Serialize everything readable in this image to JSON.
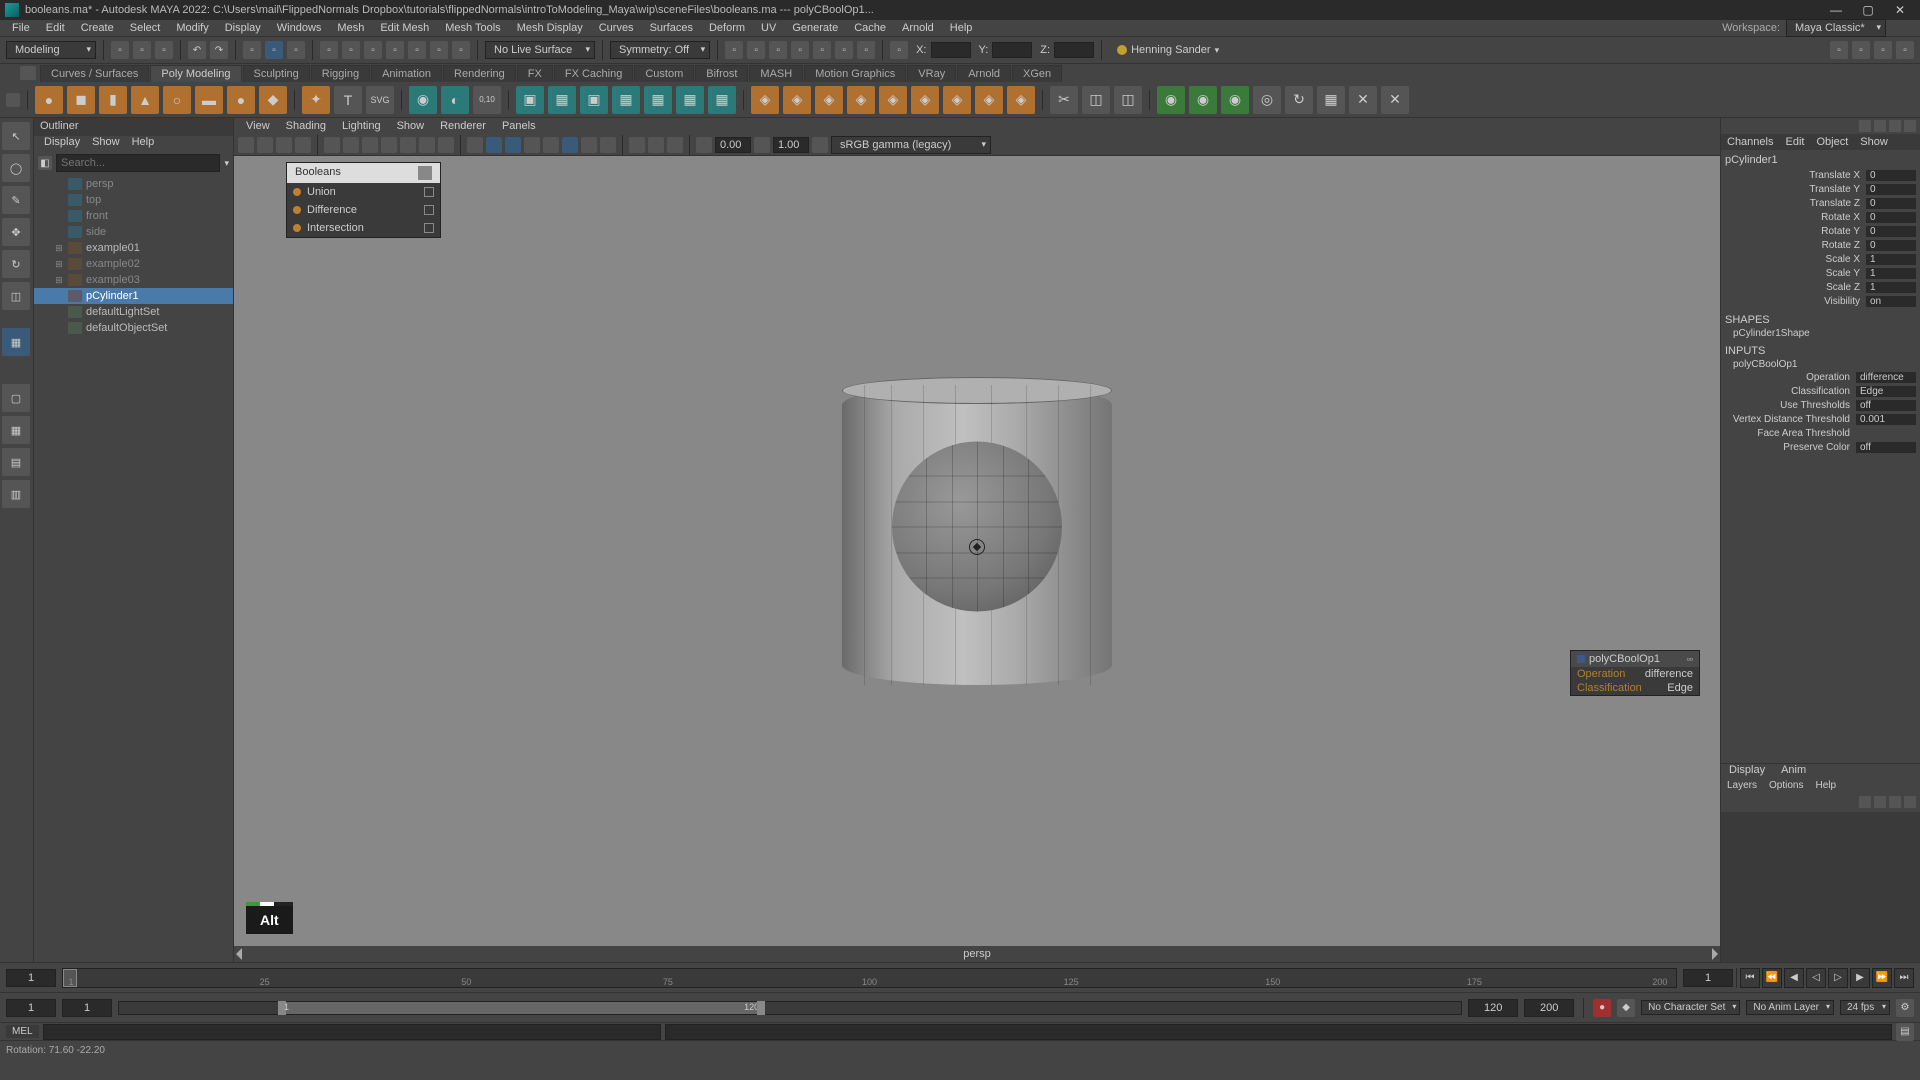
{
  "title": "booleans.ma* - Autodesk MAYA 2022: C:\\Users\\mail\\FlippedNormals Dropbox\\tutorials\\flippedNormals\\introToModeling_Maya\\wip\\sceneFiles\\booleans.ma  ---  polyCBoolOp1...",
  "workspace": {
    "label": "Workspace:",
    "value": "Maya Classic*"
  },
  "modeDropdown": "Modeling",
  "menubar": [
    "File",
    "Edit",
    "Create",
    "Select",
    "Modify",
    "Display",
    "Windows",
    "Mesh",
    "Edit Mesh",
    "Mesh Tools",
    "Mesh Display",
    "Curves",
    "Surfaces",
    "Deform",
    "UV",
    "Generate",
    "Cache",
    "Arnold",
    "Help"
  ],
  "noLiveSurface": "No Live Surface",
  "symmetry": "Symmetry: Off",
  "axes": {
    "x": "X:",
    "y": "Y:",
    "z": "Z:"
  },
  "user": "Henning Sander",
  "shelftabs": [
    "Curves / Surfaces",
    "Poly Modeling",
    "Sculpting",
    "Rigging",
    "Animation",
    "Rendering",
    "FX",
    "FX Caching",
    "Custom",
    "Bifrost",
    "MASH",
    "Motion Graphics",
    "VRay",
    "Arnold",
    "XGen"
  ],
  "shelftab_active": 1,
  "outliner": {
    "title": "Outliner",
    "menu": [
      "Display",
      "Show",
      "Help"
    ],
    "search_placeholder": "Search...",
    "items": [
      {
        "label": "persp",
        "type": "camera"
      },
      {
        "label": "top",
        "type": "camera"
      },
      {
        "label": "front",
        "type": "camera"
      },
      {
        "label": "side",
        "type": "camera"
      },
      {
        "label": "example01",
        "type": "mesh",
        "twisty": "+"
      },
      {
        "label": "example02",
        "type": "mesh",
        "twisty": "+",
        "dim": true
      },
      {
        "label": "example03",
        "type": "mesh",
        "twisty": "+",
        "dim": true
      },
      {
        "label": "pCylinder1",
        "type": "cyl",
        "selected": true
      },
      {
        "label": "defaultLightSet",
        "type": "set"
      },
      {
        "label": "defaultObjectSet",
        "type": "set"
      }
    ]
  },
  "viewport": {
    "menu": [
      "View",
      "Shading",
      "Lighting",
      "Show",
      "Renderer",
      "Panels"
    ],
    "gamma": "sRGB gamma (legacy)",
    "exposure": "0.00",
    "gammaVal": "1.00",
    "camera": "persp"
  },
  "booleans": {
    "title": "Booleans",
    "items": [
      "Union",
      "Difference",
      "Intersection"
    ]
  },
  "key_indicator": "Alt",
  "float_tooltip": {
    "header": "polyCBoolOp1",
    "rows": [
      {
        "k": "Operation",
        "v": "difference"
      },
      {
        "k": "Classification",
        "v": "Edge"
      }
    ]
  },
  "channelbox": {
    "tabs": [
      "Channels",
      "Edit",
      "Object",
      "Show"
    ],
    "obj": "pCylinder1",
    "attrs": [
      {
        "name": "Translate X",
        "val": "0"
      },
      {
        "name": "Translate Y",
        "val": "0"
      },
      {
        "name": "Translate Z",
        "val": "0"
      },
      {
        "name": "Rotate X",
        "val": "0"
      },
      {
        "name": "Rotate Y",
        "val": "0"
      },
      {
        "name": "Rotate Z",
        "val": "0"
      },
      {
        "name": "Scale X",
        "val": "1"
      },
      {
        "name": "Scale Y",
        "val": "1"
      },
      {
        "name": "Scale Z",
        "val": "1"
      },
      {
        "name": "Visibility",
        "val": "on"
      }
    ],
    "shapes_hdr": "SHAPES",
    "shape": "pCylinder1Shape",
    "inputs_hdr": "INPUTS",
    "input": "polyCBoolOp1",
    "input_attrs": [
      {
        "name": "Operation",
        "val": "difference"
      },
      {
        "name": "Classification",
        "val": "Edge"
      },
      {
        "name": "Use Thresholds",
        "val": "off"
      },
      {
        "name": "Vertex Distance Threshold",
        "val": "0.001"
      },
      {
        "name": "Face Area Threshold",
        "val": ""
      },
      {
        "name": "Preserve Color",
        "val": "off"
      }
    ]
  },
  "layers": {
    "tabs": [
      "Display",
      "Anim"
    ],
    "menu": [
      "Layers",
      "Options",
      "Help"
    ]
  },
  "timeslider": {
    "start": "1",
    "end": "200",
    "current": "1",
    "ticks": [
      "1",
      "25",
      "50",
      "75",
      "100",
      "125",
      "150",
      "175",
      "200"
    ],
    "ticks2": [
      "120",
      "200"
    ]
  },
  "rangeslider": {
    "start": "1",
    "in": "1",
    "out": "120",
    "end": "200",
    "noCharSet": "No Character Set",
    "noAnimLayer": "No Anim Layer",
    "fps": "24 fps"
  },
  "cmdline_lang": "MEL",
  "helpline": "Rotation:   71.60     -22.20"
}
